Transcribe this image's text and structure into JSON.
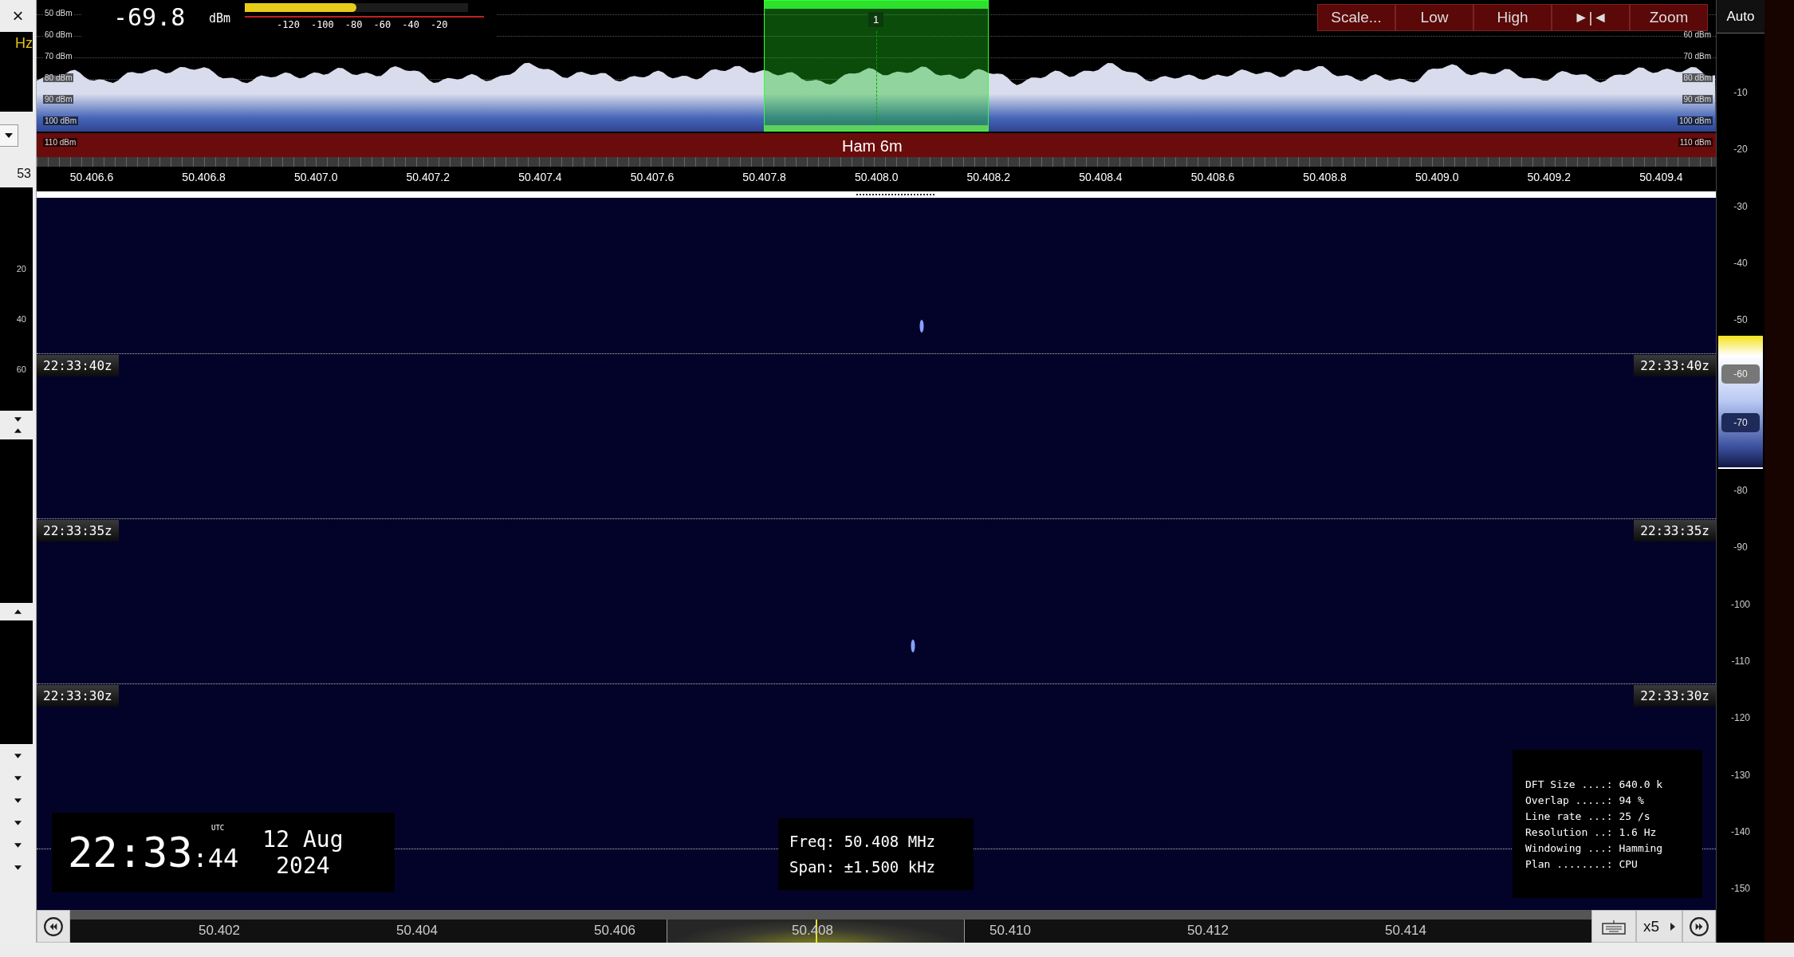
{
  "sidebar": {
    "close": "×",
    "unit": "Hz",
    "value": "53",
    "scale": [
      "20",
      "40",
      "60"
    ]
  },
  "spectrum": {
    "levels_left": [
      "50 dBm",
      "60 dBm",
      "70 dBm",
      "80 dBm",
      "90 dBm",
      "100 dBm",
      "110 dBm"
    ],
    "levels_right": [
      "60 dBm",
      "70 dBm",
      "80 dBm",
      "90 dBm",
      "100 dBm",
      "110 dBm"
    ],
    "meter": {
      "reading": "-69.8",
      "unit": "dBm",
      "level": 0.5,
      "ticks": [
        "-120",
        "-100",
        "-80",
        "-60",
        "-40",
        "-20"
      ]
    },
    "passband": {
      "label": "1"
    },
    "band": {
      "label": "Ham 6m"
    },
    "toolbar": [
      "Scale...",
      "Low",
      "High",
      "►|◄",
      "Zoom"
    ],
    "freq_ticks": [
      "50.406.6",
      "50.406.8",
      "50.407.0",
      "50.407.2",
      "50.407.4",
      "50.407.6",
      "50.407.8",
      "50.408.0",
      "50.408.2",
      "50.408.4",
      "50.408.6",
      "50.408.8",
      "50.409.0",
      "50.409.2",
      "50.409.4"
    ]
  },
  "waterfall": {
    "time_marks": [
      {
        "left": "22:33:40z",
        "right": "22:33:40z"
      },
      {
        "left": "22:33:35z",
        "right": "22:33:35z"
      },
      {
        "left": "22:33:30z",
        "right": "22:33:30z"
      }
    ]
  },
  "clock": {
    "time": "22:33",
    "seconds": ":44",
    "zone": "UTC",
    "date": "12 Aug",
    "year": "2024"
  },
  "center_info": [
    "Freq: 50.408 MHz",
    "Span: ±1.500 kHz"
  ],
  "dft_info": [
    "DFT Size ....: 640.0 k",
    "Overlap .....: 94 %",
    "Line rate ...: 25 /s",
    "Resolution ..: 1.6 Hz",
    "Windowing ...: Hamming",
    "Plan ........: CPU"
  ],
  "ruler": {
    "ticks": [
      "50.402",
      "50.404",
      "50.406",
      "50.408",
      "50.410",
      "50.412",
      "50.414"
    ],
    "zoom": "x5"
  },
  "scale_panel": {
    "mode": "Auto",
    "ticks": [
      {
        "label": "-10",
        "kind": "tick"
      },
      {
        "label": "-20",
        "kind": "tick"
      },
      {
        "label": "-30",
        "kind": "tick"
      },
      {
        "label": "-40",
        "kind": "tick"
      },
      {
        "label": "-50",
        "kind": "tick"
      },
      {
        "label": "-60",
        "kind": "handle"
      },
      {
        "label": "-70",
        "kind": "handle"
      },
      {
        "label": "-80",
        "kind": "tick"
      },
      {
        "label": "-90",
        "kind": "tick"
      },
      {
        "label": "-100",
        "kind": "tick"
      },
      {
        "label": "-110",
        "kind": "tick"
      },
      {
        "label": "-120",
        "kind": "tick"
      },
      {
        "label": "-130",
        "kind": "tick"
      },
      {
        "label": "-140",
        "kind": "tick"
      },
      {
        "label": "-150",
        "kind": "tick"
      }
    ]
  }
}
